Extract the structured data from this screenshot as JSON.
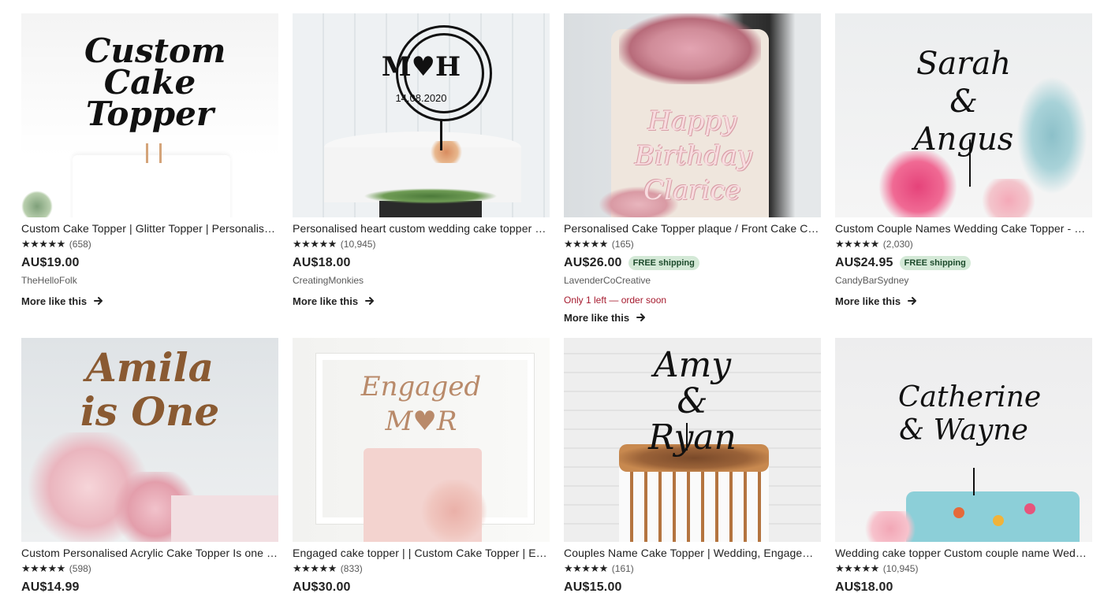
{
  "listings": [
    {
      "title": "Custom Cake Topper | Glitter Topper | Personalised Cake Topper | Birthday Cake Topper",
      "stars": "★★★★★",
      "rating_value": 5,
      "reviews": "(658)",
      "price": "AU$19.00",
      "shop": "TheHelloFolk",
      "free_shipping": "",
      "urgency": "",
      "more_label": "More like this",
      "image_text": "Custom Cake Topper"
    },
    {
      "title": "Personalised heart custom wedding cake topper with names and date",
      "stars": "★★★★★",
      "rating_value": 5,
      "reviews": "(10,945)",
      "price": "AU$18.00",
      "shop": "CreatingMonkies",
      "free_shipping": "",
      "urgency": "",
      "more_label": "More like this",
      "image_text": "M♥H",
      "image_subtext": "14.08.2020"
    },
    {
      "title": "Personalised Cake Topper plaque / Front Cake Charm",
      "stars": "★★★★★",
      "rating_value": 4.5,
      "reviews": "(165)",
      "price": "AU$26.00",
      "shop": "LavenderCoCreative",
      "free_shipping": "FREE shipping",
      "urgency": "Only 1 left — order soon",
      "more_label": "More like this",
      "image_text": "Happy Birthday Clarice"
    },
    {
      "title": "Custom Couple Names Wedding Cake Topper - Script Style",
      "stars": "★★★★★",
      "rating_value": 5,
      "reviews": "(2,030)",
      "price": "AU$24.95",
      "shop": "CandyBarSydney",
      "free_shipping": "FREE shipping",
      "urgency": "",
      "more_label": "More like this",
      "image_text": "Sarah & Angus"
    },
    {
      "title": "Custom Personalised Acrylic Cake Topper Is one Birthday Name Topper",
      "stars": "★★★★★",
      "rating_value": 5,
      "reviews": "(598)",
      "price": "AU$14.99",
      "image_text": "Amila is One"
    },
    {
      "title": "Engaged cake topper | | Custom Cake Topper | Engagement Initials",
      "stars": "★★★★★",
      "rating_value": 5,
      "reviews": "(833)",
      "price": "AU$30.00",
      "image_text": "Engaged M♥R"
    },
    {
      "title": "Couples Name Cake Topper | Wedding, Engagement Topper",
      "stars": "★★★★★",
      "rating_value": 5,
      "reviews": "(161)",
      "price": "AU$15.00",
      "image_text": "Amy & Ryan"
    },
    {
      "title": "Wedding cake topper Custom couple name Wedding topper",
      "stars": "★★★★★",
      "rating_value": 5,
      "reviews": "(10,945)",
      "price": "AU$18.00",
      "image_text": "Catherine & Wayne"
    }
  ],
  "colors": {
    "free_shipping_bg": "#d4e9d7",
    "free_shipping_text": "#1d4b2c",
    "urgency": "#a61a2e"
  },
  "icons": {
    "more_arrow": "arrow-right-icon",
    "star": "star-icon"
  }
}
